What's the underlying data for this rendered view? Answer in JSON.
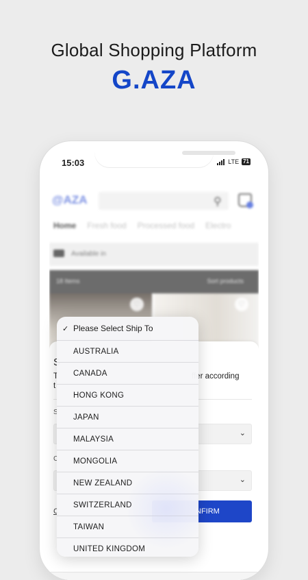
{
  "promo": {
    "headline": "Global Shopping Platform",
    "brand": "G.AZA"
  },
  "status_bar": {
    "time": "15:03",
    "network": "LTE",
    "battery": "71"
  },
  "app": {
    "logo": "@AZA",
    "categories": [
      "Home",
      "Fresh food",
      "Processed food",
      "Electro"
    ],
    "availability": "Available in",
    "items_count": "18 Items",
    "sort_label": "Sort products"
  },
  "sheet": {
    "title": "S",
    "description_start": "T",
    "description_line2": "t",
    "description_tail": "ffer according",
    "field1_label": "S",
    "field2_label": "C",
    "cancel_label": "C",
    "confirm_label": "NFIRM"
  },
  "ship_to_dropdown": {
    "header": "Please Select Ship To",
    "options": [
      "AUSTRALIA",
      "CANADA",
      "HONG KONG",
      "JAPAN",
      "MALAYSIA",
      "MONGOLIA",
      "NEW ZEALAND",
      "SWITZERLAND",
      "TAIWAN",
      "UNITED KINGDOM"
    ]
  }
}
